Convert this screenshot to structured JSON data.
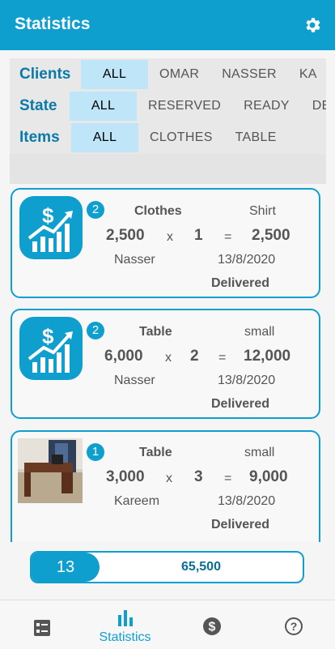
{
  "header": {
    "title": "Statistics"
  },
  "filters": {
    "clients": {
      "label": "Clients",
      "options": [
        "ALL",
        "OMAR",
        "NASSER",
        "KA"
      ]
    },
    "state": {
      "label": "State",
      "options": [
        "ALL",
        "RESERVED",
        "READY",
        "DE"
      ]
    },
    "items": {
      "label": "Items",
      "options": [
        "ALL",
        "CLOTHES",
        "TABLE"
      ]
    }
  },
  "orders": [
    {
      "badge": "2",
      "item": "Clothes",
      "variant": "Shirt",
      "price": "2,500",
      "times": "x",
      "qty": "1",
      "eq": "=",
      "total": "2,500",
      "client": "Nasser",
      "date": "13/8/2020",
      "status": "Delivered"
    },
    {
      "badge": "2",
      "item": "Table",
      "variant": "small",
      "price": "6,000",
      "times": "x",
      "qty": "2",
      "eq": "=",
      "total": "12,000",
      "client": "Nasser",
      "date": "13/8/2020",
      "status": "Delivered"
    },
    {
      "badge": "1",
      "item": "Table",
      "variant": "small",
      "price": "3,000",
      "times": "x",
      "qty": "3",
      "eq": "=",
      "total": "9,000",
      "client": "Kareem",
      "date": "13/8/2020",
      "status": "Delivered"
    }
  ],
  "summary": {
    "count": "13",
    "total": "65,500"
  },
  "nav": {
    "statistics_label": "Statistics"
  },
  "colors": {
    "primary": "#0f9fcf",
    "chip_active": "#bfe6f8"
  },
  "icons": [
    "gear-icon",
    "money-growth-icon",
    "list-icon",
    "bar-chart-icon",
    "dollar-icon",
    "help-icon"
  ]
}
